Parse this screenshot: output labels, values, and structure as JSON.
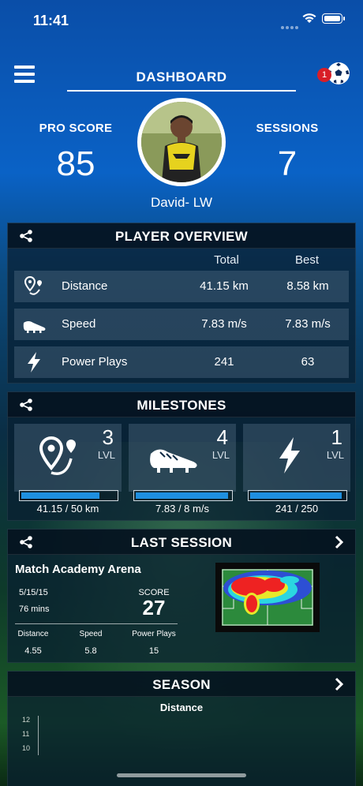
{
  "status": {
    "time": "11:41"
  },
  "nav": {
    "title": "DASHBOARD",
    "badge": "1"
  },
  "header": {
    "pro_score_label": "PRO SCORE",
    "pro_score": "85",
    "sessions_label": "SESSIONS",
    "sessions": "7",
    "player_name": "David- LW"
  },
  "overview": {
    "title": "PLAYER OVERVIEW",
    "col_total": "Total",
    "col_best": "Best",
    "rows": [
      {
        "label": "Distance",
        "total": "41.15 km",
        "best": "8.58 km"
      },
      {
        "label": "Speed",
        "total": "7.83 m/s",
        "best": "7.83 m/s"
      },
      {
        "label": "Power Plays",
        "total": "241",
        "best": "63"
      }
    ]
  },
  "milestones": {
    "title": "MILESTONES",
    "lvl_label": "LVL",
    "items": [
      {
        "level": "3",
        "progress_text": "41.15 / 50 km",
        "progress": 0.823
      },
      {
        "level": "4",
        "progress_text": "7.83 / 8 m/s",
        "progress": 0.979
      },
      {
        "level": "1",
        "progress_text": "241 / 250",
        "progress": 0.964
      }
    ]
  },
  "last_session": {
    "title": "LAST SESSION",
    "venue": "Match Academy Arena",
    "date": "5/15/15",
    "duration": "76 mins",
    "score_label": "SCORE",
    "score": "27",
    "stats": [
      {
        "label": "Distance",
        "value": "4.55"
      },
      {
        "label": "Speed",
        "value": "5.8"
      },
      {
        "label": "Power Plays",
        "value": "15"
      }
    ]
  },
  "season": {
    "title": "SEASON",
    "subtitle": "Distance",
    "ticks": [
      "12",
      "11",
      "10"
    ]
  },
  "colors": {
    "accent": "#1e8fe0",
    "badge": "#d81e27"
  }
}
